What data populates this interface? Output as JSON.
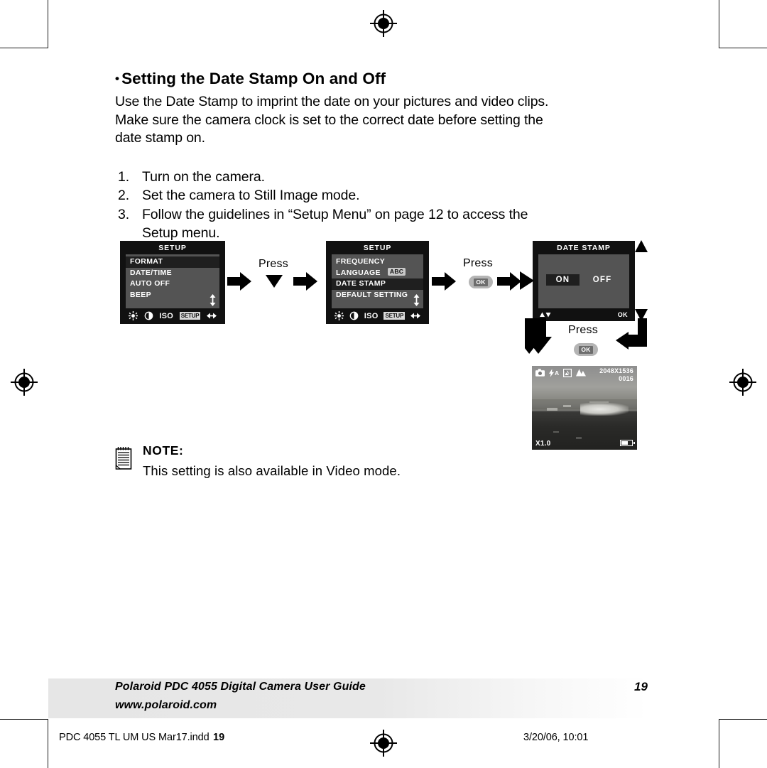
{
  "heading": {
    "bullet": "•",
    "text": "Setting the Date Stamp On and Off"
  },
  "intro": "Use the Date Stamp to imprint the date on your pictures and video clips.\nMake sure the camera clock is set to the correct date before setting the\ndate stamp on.",
  "steps": [
    {
      "num": "1.",
      "text": "Turn on the camera."
    },
    {
      "num": "2.",
      "text": "Set the camera to Still Image mode."
    },
    {
      "num": "3.",
      "line1": "Follow the guidelines in “Setup Menu” on page 12 to access the",
      "line2": "Setup menu."
    }
  ],
  "screens": {
    "screen1": {
      "title": "SETUP",
      "rows": [
        {
          "label": "FORMAT",
          "selected": true
        },
        {
          "label": "DATE/TIME",
          "selected": false
        },
        {
          "label": "AUTO OFF",
          "selected": false
        },
        {
          "label": "BEEP",
          "selected": false
        }
      ],
      "bar": [
        "brightness-icon",
        "contrast-icon",
        "ISO",
        "SETUP",
        "left-right-icon"
      ],
      "iso_label": "ISO",
      "setup_label": "SETUP"
    },
    "screen2": {
      "title": "SETUP",
      "rows": [
        {
          "label": "FREQUENCY",
          "selected": false,
          "badge": ""
        },
        {
          "label": "LANGUAGE",
          "selected": false,
          "badge": "ABC"
        },
        {
          "label": "DATE STAMP",
          "selected": true,
          "badge": ""
        },
        {
          "label": "DEFAULT SETTING",
          "selected": false,
          "badge": ""
        }
      ],
      "iso_label": "ISO",
      "setup_label": "SETUP"
    },
    "screen3": {
      "title": "DATE STAMP",
      "option_on": "ON",
      "option_off": "OFF",
      "selected": "ON",
      "ok_label": "OK"
    }
  },
  "press_labels": {
    "press1": "Press",
    "press2": "Press",
    "press3": "Press"
  },
  "ok_button_label": "OK",
  "preview": {
    "icons": [
      "camera-icon",
      "flash-auto-icon",
      "exposure-icon",
      "landscape-icon"
    ],
    "flash_label": "A",
    "resolution": "2048X1536",
    "shots_remaining": "0016",
    "zoom": "X1.0"
  },
  "note": {
    "title": "NOTE:",
    "text": "This setting is also available in Video mode."
  },
  "footer": {
    "line1": "Polaroid PDC 4055 Digital Camera User Guide",
    "line2": "www.polaroid.com",
    "page": "19"
  },
  "printline": {
    "file": "PDC 4055 TL UM US Mar17.indd",
    "page": "19",
    "date": "3/20/06, 10:01"
  },
  "colors": {
    "lcd_bg": "#111111",
    "lcd_panel": "#545454",
    "lcd_selected": "#1f1f1f",
    "footer_band": "#e6e6e6"
  }
}
